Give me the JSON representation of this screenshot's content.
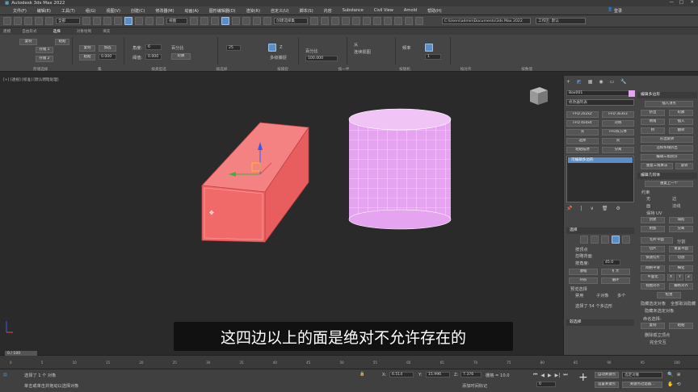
{
  "window": {
    "title": "Autodesk 3ds Max 2022"
  },
  "menu": [
    "文件(F)",
    "编辑(E)",
    "工具(T)",
    "组(G)",
    "视图(V)",
    "创建(C)",
    "修改器(M)",
    "动画(A)",
    "图形编辑器(D)",
    "渲染(R)",
    "自定义(U)",
    "脚本(S)",
    "内容",
    "Substance",
    "Civil View",
    "Arnold",
    "帮助(H)"
  ],
  "toolbar": {
    "filter": "全部",
    "view": "视图",
    "selset": "创建选择集",
    "path": "C:\\Users\\admin\\Documents\\3ds Max 2022",
    "sign_in": "登录",
    "workspace": "工作区: 默认"
  },
  "ribbon_tabs": [
    "建模",
    "自由形式",
    "选择",
    "对象绘制",
    "填充"
  ],
  "ribbon": {
    "g1": [
      "复制",
      "存储 1",
      "存储 2",
      "粘贴"
    ],
    "g2": [
      "复制",
      "粘贴",
      "加选",
      "0.000"
    ],
    "angle_label": "角度:",
    "angle": "6",
    "percent": "百分比",
    "dist_label": "阈值:",
    "dist": "0.000",
    "dist_btn": "轮廓",
    "step": "25",
    "scale": "Z",
    "mirror": "多级捕捉",
    "percent2": "百分比",
    "percent_val": "100.000",
    "from_label": "从",
    "to_label": "连续视图",
    "smooth": "1",
    "freq_label": "频率",
    "group_names": [
      "存储选择",
      "集",
      "按类型选",
      "按选择",
      "按捕捉",
      "按一半",
      "按随机",
      "按对齐",
      "按数值"
    ]
  },
  "viewport": {
    "label": "[+] [透视] [标准] [默认明暗处理]"
  },
  "cmd": {
    "objname": "Box001",
    "modlist": "修改器列表",
    "mods": [
      [
        "FFD 2x2x2",
        "FFD 3x3x3"
      ],
      [
        "FFD 4x4x4",
        "对称"
      ],
      [
        "壳",
        "FFD长方体"
      ],
      [
        "选择",
        "壳"
      ],
      [
        "粘贴描述",
        "分离"
      ]
    ],
    "stack_item": "可编辑多边形",
    "sec_sel": "选择",
    "ignore_back": "忽略背面",
    "by_vertex": "按顶点",
    "by_angle": "按角度:",
    "angle_val": "45.0",
    "shrink": "收缩",
    "grow": "扩大",
    "ring": "环形",
    "loop": "循环",
    "preview": "预览选择",
    "disable": "禁用",
    "subobj": "子对象",
    "multi": "多个",
    "count": "选择了 54 个多边形",
    "soft": "软选择",
    "edit_poly": "编辑多边形",
    "insert_vertex": "插入顶点",
    "ep_btns": [
      [
        "挤出",
        "轮廓"
      ],
      [
        "倒角",
        "插入"
      ],
      [
        "桥",
        "翻转"
      ],
      [
        "从边旋转"
      ],
      [
        "沿样条线挤出"
      ],
      [
        "编辑三角剖分"
      ],
      [
        "重复三角算法",
        "旋转"
      ]
    ],
    "edit_geom": "编辑几何体",
    "repeat_last": "重复上一个",
    "constraint": "约束",
    "none": "无",
    "edge": "边",
    "face": "面",
    "normal": "法线",
    "preserve_uv": "保持 UV",
    "create": "创建",
    "collapse": "塌陷",
    "attach": "附加",
    "detach": "分离",
    "slice_plane": "切片平面",
    "split": "分割",
    "slice": "切片",
    "reset_plane": "重置平面",
    "quickslice": "快速切片",
    "cut": "切割",
    "msmooth": "网格平滑",
    "tessellate": "细化",
    "make_planar": "平面化",
    "xyz": [
      "X",
      "Y",
      "Z"
    ],
    "view_align": "视图对齐",
    "grid_align": "栅格对齐",
    "relax": "松弛",
    "hide_sel": "隐藏选定对象",
    "unhide_all": "全部取消隐藏",
    "hide_unsel": "隐藏未选定对象",
    "named_sel": "命名选择:",
    "copy": "复制",
    "paste": "粘贴",
    "del_iso": "删除孤立顶点",
    "full_int": "完全交互"
  },
  "subtitle": "这四边以上的面是绝对不允许存在的",
  "timeline": {
    "frame": "0 / 100",
    "ticks": [
      "0",
      "5",
      "10",
      "15",
      "20",
      "25",
      "30",
      "35",
      "40",
      "45",
      "50",
      "55",
      "60",
      "65",
      "70",
      "75",
      "80",
      "85",
      "90",
      "95",
      "100"
    ]
  },
  "status": {
    "selected": "选择了 1 个 对象",
    "hint": "单击或单击并拖动以选择对象",
    "x_val": "6.514",
    "y_val": "15.996",
    "z_val": "7.376",
    "grid": "栅格 = 10.0",
    "addtime": "添加时间标记",
    "autokey": "自动关键点",
    "selobj": "选定对象",
    "setkey": "设置关键点",
    "keyfilter": "关键点过滤器...",
    "frame_num": "0"
  },
  "colors": {
    "box": "#f06a6a",
    "cylinder": "#e5a4ef",
    "accent": "#5b8dc7"
  }
}
